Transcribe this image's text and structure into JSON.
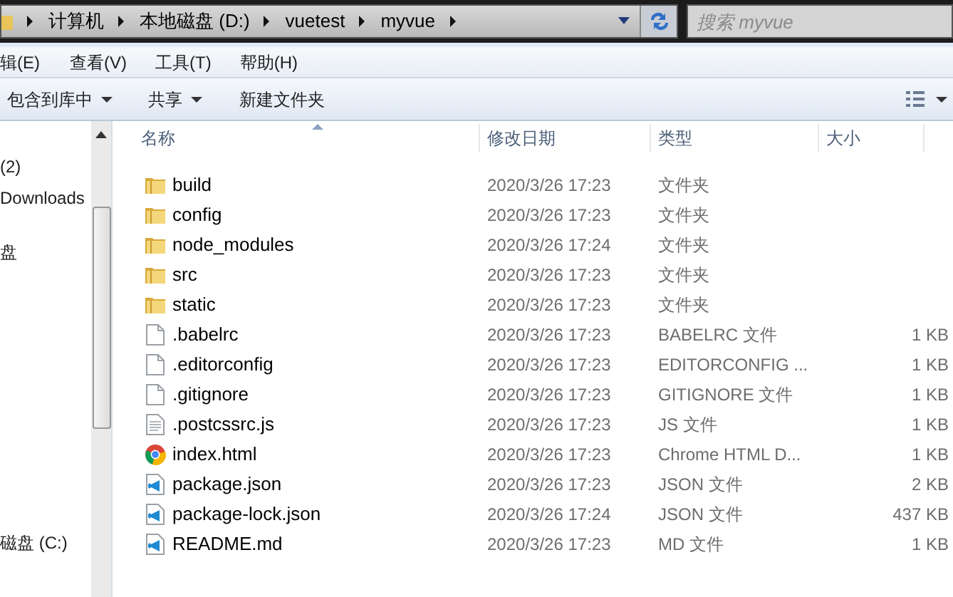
{
  "address_bar": {
    "crumbs": [
      "计算机",
      "本地磁盘 (D:)",
      "vuetest",
      "myvue"
    ]
  },
  "search": {
    "placeholder": "搜索 myvue"
  },
  "menu": [
    "辑(E)",
    "查看(V)",
    "工具(T)",
    "帮助(H)"
  ],
  "toolbar": [
    {
      "label": "包含到库中",
      "dropdown": true
    },
    {
      "label": "共享",
      "dropdown": true
    },
    {
      "label": "新建文件夹",
      "dropdown": false
    }
  ],
  "nav": [
    "(2)",
    "Downloads",
    "盘",
    "磁盘 (C:)"
  ],
  "columns": [
    "名称",
    "修改日期",
    "类型",
    "大小"
  ],
  "rows": [
    {
      "kind": "folder",
      "name": "build",
      "modified": "2020/3/26 17:23",
      "type": "文件夹",
      "size": ""
    },
    {
      "kind": "folder",
      "name": "config",
      "modified": "2020/3/26 17:23",
      "type": "文件夹",
      "size": ""
    },
    {
      "kind": "folder",
      "name": "node_modules",
      "modified": "2020/3/26 17:24",
      "type": "文件夹",
      "size": ""
    },
    {
      "kind": "folder",
      "name": "src",
      "modified": "2020/3/26 17:23",
      "type": "文件夹",
      "size": ""
    },
    {
      "kind": "folder",
      "name": "static",
      "modified": "2020/3/26 17:23",
      "type": "文件夹",
      "size": ""
    },
    {
      "kind": "file",
      "name": ".babelrc",
      "modified": "2020/3/26 17:23",
      "type": "BABELRC 文件",
      "size": "1 KB"
    },
    {
      "kind": "file",
      "name": ".editorconfig",
      "modified": "2020/3/26 17:23",
      "type": "EDITORCONFIG ...",
      "size": "1 KB"
    },
    {
      "kind": "file",
      "name": ".gitignore",
      "modified": "2020/3/26 17:23",
      "type": "GITIGNORE 文件",
      "size": "1 KB"
    },
    {
      "kind": "text",
      "name": ".postcssrc.js",
      "modified": "2020/3/26 17:23",
      "type": "JS 文件",
      "size": "1 KB"
    },
    {
      "kind": "chrome",
      "name": "index.html",
      "modified": "2020/3/26 17:23",
      "type": "Chrome HTML D...",
      "size": "1 KB"
    },
    {
      "kind": "vscode",
      "name": "package.json",
      "modified": "2020/3/26 17:23",
      "type": "JSON 文件",
      "size": "2 KB"
    },
    {
      "kind": "vscode",
      "name": "package-lock.json",
      "modified": "2020/3/26 17:24",
      "type": "JSON 文件",
      "size": "437 KB"
    },
    {
      "kind": "vscode",
      "name": "README.md",
      "modified": "2020/3/26 17:23",
      "type": "MD 文件",
      "size": "1 KB"
    }
  ]
}
